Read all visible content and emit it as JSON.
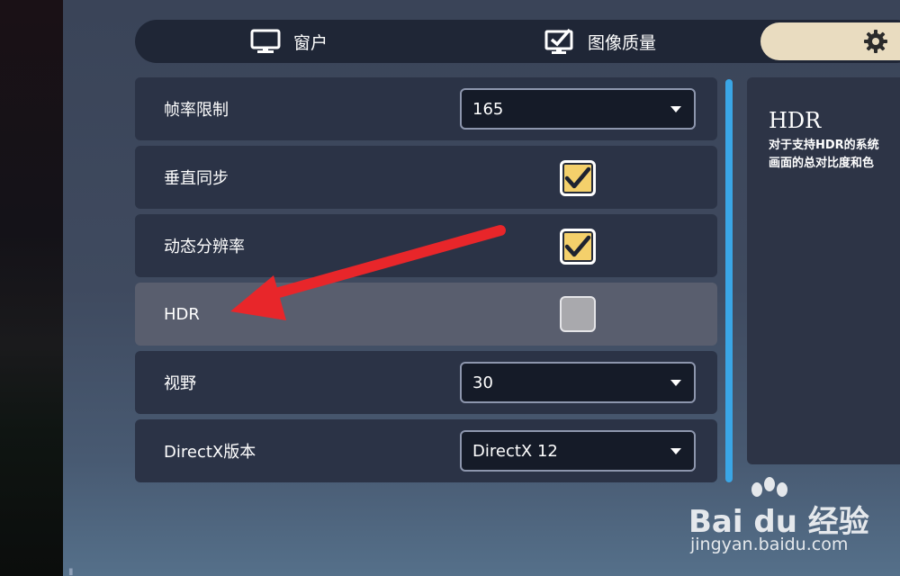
{
  "tabs": [
    {
      "label": "窗户",
      "icon": "monitor-icon"
    },
    {
      "label": "图像质量",
      "icon": "monitor-check-icon"
    },
    {
      "label": "",
      "icon": "gear-icon",
      "active": true
    }
  ],
  "settings": [
    {
      "label": "帧率限制",
      "type": "dropdown",
      "value": "165"
    },
    {
      "label": "垂直同步",
      "type": "checkbox",
      "checked": true
    },
    {
      "label": "动态分辨率",
      "type": "checkbox",
      "checked": true
    },
    {
      "label": "HDR",
      "type": "checkbox",
      "checked": false,
      "highlighted": true
    },
    {
      "label": "视野",
      "type": "dropdown",
      "value": "30"
    },
    {
      "label": "DirectX版本",
      "type": "dropdown",
      "value": "DirectX 12"
    }
  ],
  "description": {
    "title": "HDR",
    "line1": "对于支持HDR的系统",
    "line2": "画面的总对比度和色"
  },
  "watermark": {
    "logo": "Bai du 经验",
    "url": "jingyan.baidu.com"
  },
  "colors": {
    "accent_check": "#f4d06b",
    "active_tab": "#e9dcc0",
    "scrollbar": "#3aa6e6",
    "annotation_arrow": "#e8262a"
  }
}
